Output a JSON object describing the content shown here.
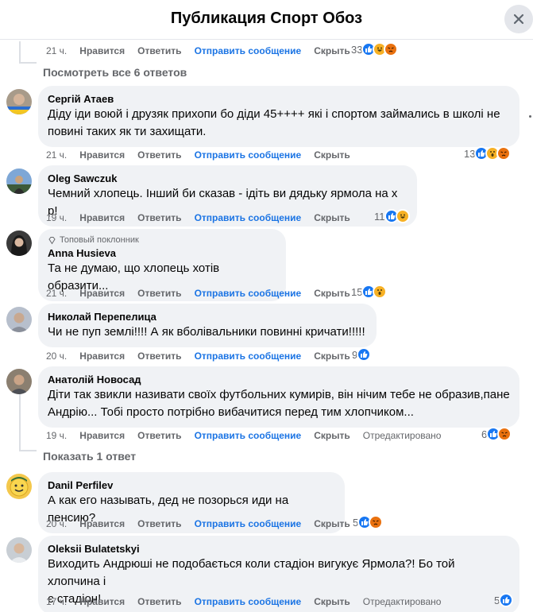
{
  "header": {
    "title": "Публикация Спорт Обоз"
  },
  "labels": {
    "like": "Нравится",
    "reply": "Ответить",
    "send": "Отправить сообщение",
    "hide": "Скрыть",
    "edited": "Отредактировано"
  },
  "top_actions": {
    "time": "21 ч.",
    "reactions": "33"
  },
  "view_replies": "Посмотреть все 6 ответов",
  "show_reply": "Показать 1 ответ",
  "colors": {
    "like": "#1877f2",
    "haha": "#f7b125",
    "wow": "#f7b125",
    "angry": "#e9710f",
    "link": "#1b74e4",
    "bubble": "#f0f2f5"
  },
  "comments": [
    {
      "author": "Сергій Атаев",
      "text": "Діду іди воюй і друзяк прихопи бо діди 45++++ які і спортом займались в школі не\nповині таких як ти захищати.",
      "time": "21 ч.",
      "reactions": "13",
      "reaction_icons": [
        "like",
        "wow",
        "angry"
      ]
    },
    {
      "author": "Oleg Sawczuk",
      "text": "Чемний хлопець. Інший би сказав - ідіть ви дядьку ярмола на х р!",
      "time": "19 ч.",
      "reactions": "11",
      "reaction_icons": [
        "like",
        "haha"
      ]
    },
    {
      "badge": "Топовый поклонник",
      "author": "Anna Husieva",
      "text": "Та не думаю, що хлопець хотів образити...",
      "time": "21 ч.",
      "reactions": "15",
      "reaction_icons": [
        "like",
        "wow"
      ]
    },
    {
      "author": "Николай Перепелица",
      "text": "Чи не пуп землі!!!! А як вболівальники повинні кричати!!!!!",
      "time": "20 ч.",
      "reactions": "9",
      "reaction_icons": [
        "like"
      ]
    },
    {
      "author": "Анатолій Новосад",
      "text": "Діти так звикли називати своїх футбольних кумирів, він нічим тебе не образив,пане\nАндрію... Тобі просто потрібно вибачитися перед тим хлопчиком...",
      "time": "19 ч.",
      "reactions": "6",
      "reaction_icons": [
        "like",
        "angry"
      ],
      "edited": true
    },
    {
      "author": "Danil Perfilev",
      "text": "А как его называть, дед не позорься иди на пенсию?",
      "time": "20 ч.",
      "reactions": "5",
      "reaction_icons": [
        "like",
        "angry"
      ]
    },
    {
      "author": "Oleksii Bulatetskyi",
      "text": "Виходить Андрюші не подобається коли стадіон вигукує Ярмола?! Бо той хлопчина і\nє стадіон!",
      "time": "17 ч.",
      "reactions": "5",
      "reaction_icons": [
        "like"
      ],
      "edited": true
    }
  ]
}
